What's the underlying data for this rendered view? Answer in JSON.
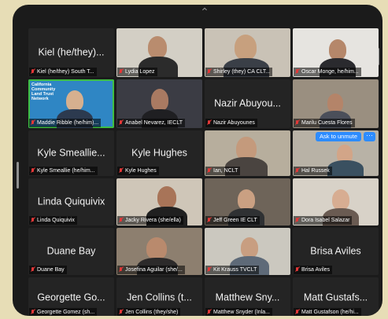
{
  "participants": [
    {
      "big_name": "Kiel (he/they)...",
      "label": "Kiel (he/they) South T..."
    },
    {
      "big_name": "",
      "label": "Lydia Lopez"
    },
    {
      "big_name": "",
      "label": "Shirley (they) CA CLT..."
    },
    {
      "big_name": "",
      "label": "Oscar Monge, he/him..."
    },
    {
      "big_name": "",
      "label": "Maddie Ribble (he/him)...",
      "logo": "California Community Land Trust Network"
    },
    {
      "big_name": "",
      "label": "Anabel Nevarez, IECLT"
    },
    {
      "big_name": "Nazir Abuyou...",
      "label": "Nazir Abuyounes"
    },
    {
      "big_name": "",
      "label": "Marilu Cuesta Flores"
    },
    {
      "big_name": "Kyle Smeallie...",
      "label": "Kyle Smeallie (he/him..."
    },
    {
      "big_name": "Kyle Hughes",
      "label": "Kyle Hughes"
    },
    {
      "big_name": "",
      "label": "Ian, NCLT"
    },
    {
      "big_name": "",
      "label": "Hal Russek",
      "unmute_label": "Ask to unmute",
      "more_label": "···"
    },
    {
      "big_name": "Linda Quiquivix",
      "label": "Linda Quiquivix"
    },
    {
      "big_name": "",
      "label": "Jacky Rivera (she/ella)"
    },
    {
      "big_name": "",
      "label": "Jeff Green IE CLT"
    },
    {
      "big_name": "",
      "label": "Dora Isabel Salazar"
    },
    {
      "big_name": "Duane Bay",
      "label": "Duane Bay"
    },
    {
      "big_name": "",
      "label": "Josefina Aguilar (she/..."
    },
    {
      "big_name": "",
      "label": "Kit Krauss TVCLT"
    },
    {
      "big_name": "Brisa Aviles",
      "label": "Brisa Aviles"
    },
    {
      "big_name": "Georgette Go...",
      "label": "Georgette Gomez (sh..."
    },
    {
      "big_name": "Jen Collins (t...",
      "label": "Jen Collins (they/she)"
    },
    {
      "big_name": "Matthew Sny...",
      "label": "Matthew Snyder (Inla..."
    },
    {
      "big_name": "Matt Gustafs...",
      "label": "Matt Gustafson (he/hi..."
    }
  ],
  "colors": {
    "background": "#e7ddb6",
    "tablet": "#1b1b1b",
    "tile": "#242424",
    "active_border": "#3fbf44",
    "muted_mic": "#e33838",
    "unmute_button": "#2d8cff"
  },
  "icons": {
    "mic": "microphone-muted-icon",
    "camera": "chevron-up-icon"
  }
}
